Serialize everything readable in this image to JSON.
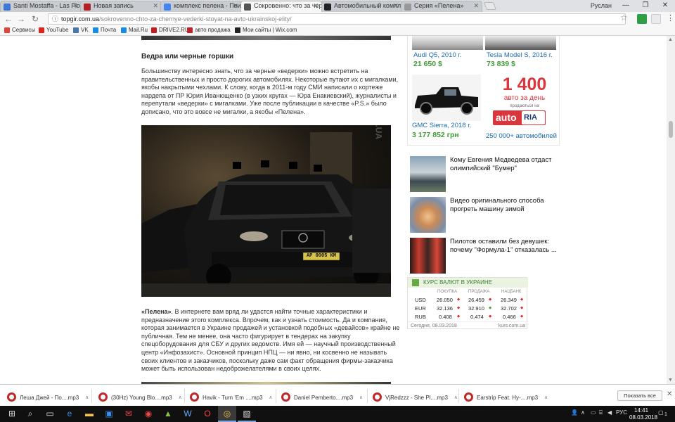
{
  "browser": {
    "tabs": [
      {
        "title": "Santi Mostaffa - Las Flores",
        "favicon_color": "#3b78d8"
      },
      {
        "title": "Новая запись",
        "favicon_color": "#b51f23"
      },
      {
        "title": "комплекс пелена - Поиск",
        "favicon_color": "#4285f4"
      },
      {
        "title": "Сокровенно: что за черные ведерки",
        "favicon_color": "#555555"
      },
      {
        "title": "Автомобильный комплекс",
        "favicon_color": "#222222"
      },
      {
        "title": "Серия «Пелена»",
        "favicon_color": "#999999"
      }
    ],
    "profile_name": "Руслан",
    "url_host": "topgir.com.ua",
    "url_path": "/sokrovenno-chto-za-chernye-vederki-stoyat-na-avto-ukrainskoj-elity/",
    "bookmarks": [
      {
        "label": "Сервисы",
        "icon_color": "#e0453a"
      },
      {
        "label": "YouTube",
        "icon_color": "#e62117"
      },
      {
        "label": "VK",
        "icon_color": "#4a76a8"
      },
      {
        "label": "Почта",
        "icon_color": "#168de2"
      },
      {
        "label": "Mail.Ru",
        "icon_color": "#168de2"
      },
      {
        "label": "DRIVE2.RU",
        "icon_color": "#c61b1b"
      },
      {
        "label": "авто продажа",
        "icon_color": "#c12128"
      },
      {
        "label": "Мои сайты | Wix.com",
        "icon_color": "#222222"
      }
    ]
  },
  "article": {
    "heading": "Ведра или черные горшки",
    "paragraph1": "Большинству интересно знать, что за черные «ведерки» можно встретить на правительственных и просто дорогих автомобилях. Некоторые путают их с мигалками, якобы накрытыми чехлами. К слову, когда в 2011-м году СМИ написали о кортеже нардепа от ПР Юрия Иванющенко (в узких кругах — Юра Енакиевский), журналисты и перепутали «ведерки» с мигалками. Уже после публикации в качестве «P.S.» было дописано, что это вовсе не мигалки, а якобы «Пелена».",
    "plate": "AP 0005 KM",
    "watermark": "LB.UA",
    "paragraph2_bold": "«Пелена»",
    "paragraph2": ". В интернете вам вряд ли удастся найти точные характеристики и предназначение этого комплекса. Впрочем, как и узнать стоимость. Да и компания, которая занимается в Украине продажей и установкой подобных «девайсов» крайне не публичная. Тем не менее, она часто фигурирует в тендерах на закупку спецоборудования для СБУ и других ведомств. Имя ей — научный производственный центр «Инфозахист». Основной принцип НПЦ — ни явно, ни косвенно не называть своих клиентов и заказчиков, поскольку даже сам факт обращения фирмы-заказчика может быть использован недоброжелателями в своих целях."
  },
  "car_ads": {
    "cars": [
      {
        "name": "Audi Q5, 2010 г.",
        "price": "21 650 $"
      },
      {
        "name": "Tesla Model S, 2016 г.",
        "price": "73 839 $"
      },
      {
        "name": "GMC Sierra, 2018 г.",
        "price": "3 177 852 грн"
      }
    ],
    "promo_number": "1 400",
    "promo_line": "авто за день",
    "promo_small": "продаються на",
    "logo_auto": "auto",
    "logo_ria": "RIA",
    "total": "250 000+ автомобилей"
  },
  "news": [
    {
      "title": "Кому Евгения Медведева отдаст олимпийский \"Бумер\""
    },
    {
      "title": "Видео оригинального способа прогреть машину зимой"
    },
    {
      "title": "Пилотов оставили без девушек: почему \"Формула-1\" отказалась ..."
    }
  ],
  "currency": {
    "title": "КУРС ВАЛЮТ В УКРАИНЕ",
    "columns": [
      "ПОКУПКА",
      "ПРОДАЖА",
      "НАЦБАНК"
    ],
    "rows": [
      {
        "code": "USD",
        "buy": "26.050",
        "sell": "26.459",
        "nbu": "26.349",
        "dirs": [
          "down",
          "down",
          "down"
        ]
      },
      {
        "code": "EUR",
        "buy": "32.136",
        "sell": "32.910",
        "nbu": "32.702",
        "dirs": [
          "down",
          "up",
          "down"
        ]
      },
      {
        "code": "RUB",
        "buy": "0.408",
        "sell": "0.474",
        "nbu": "0.466",
        "dirs": [
          "down",
          "down",
          "down"
        ]
      }
    ],
    "date_text": "Сегодня, 08.03.2018",
    "source": "kurs.com.ua"
  },
  "downloads": {
    "items": [
      {
        "name": "Леша Джей - По....mp3"
      },
      {
        "name": "(30Hz) Young Blo....mp3"
      },
      {
        "name": "Havik - Turn 'Em ....mp3"
      },
      {
        "name": "Daniel Pemberto....mp3"
      },
      {
        "name": "VjRedzzz - She Pl....mp3"
      },
      {
        "name": "Earstrip Feat. Hy-....mp3"
      }
    ],
    "show_all": "Показать все"
  },
  "taskbar": {
    "language": "РУС",
    "time": "14:41",
    "date": "08.03.2018",
    "notification_count": "1"
  }
}
